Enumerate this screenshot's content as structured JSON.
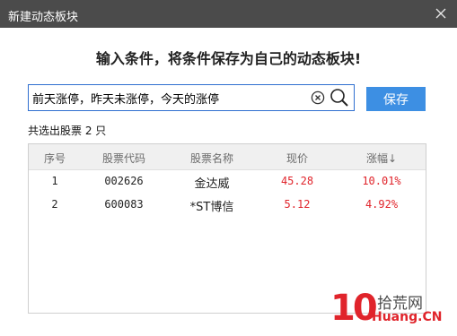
{
  "window": {
    "title": "新建动态板块",
    "close_icon": "close-icon"
  },
  "heading": "输入条件，将条件保存为自己的动态板块!",
  "search": {
    "value": "前天涨停，昨天未涨停，今天的涨停",
    "clear_icon": "clear-circle-icon",
    "search_icon": "search-icon"
  },
  "save_button": "保存",
  "result_count": "共选出股票 2 只",
  "table": {
    "columns": [
      "序号",
      "股票代码",
      "股票名称",
      "现价",
      "涨幅↓"
    ],
    "rows": [
      {
        "index": "1",
        "code": "002626",
        "name": "金达威",
        "price": "45.28",
        "change": "10.01%"
      },
      {
        "index": "2",
        "code": "600083",
        "name": "*ST博信",
        "price": "5.12",
        "change": "4.92%"
      }
    ]
  },
  "watermark": {
    "number": "10",
    "text_cn": "拾荒网",
    "text_en": "Huang.CN"
  },
  "colors": {
    "titlebar": "#4b4b4b",
    "accent": "#3d8fe3",
    "up": "#e0242b"
  }
}
